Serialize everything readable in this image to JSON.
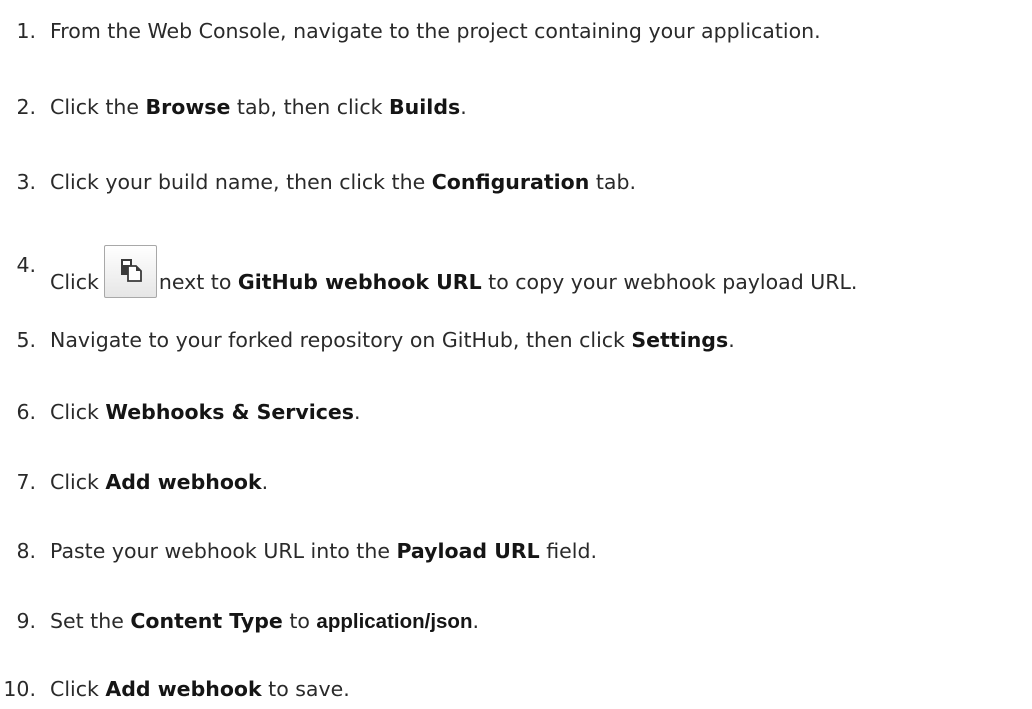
{
  "steps": [
    {
      "num": "1.",
      "parts": [
        {
          "t": "From the Web Console, navigate to the project containing your application."
        }
      ]
    },
    {
      "num": "2.",
      "parts": [
        {
          "t": "Click the "
        },
        {
          "t": "Browse",
          "bold": true
        },
        {
          "t": " tab, then click "
        },
        {
          "t": "Builds",
          "bold": true
        },
        {
          "t": "."
        }
      ]
    },
    {
      "num": "3.",
      "parts": [
        {
          "t": "Click your build name, then click the "
        },
        {
          "t": "Configuration",
          "bold": true
        },
        {
          "t": " tab."
        }
      ]
    },
    {
      "num": "4.",
      "parts": [
        {
          "t": "Click"
        },
        {
          "icon": "copy-to-clipboard-icon"
        },
        {
          "t": "next to "
        },
        {
          "t": "GitHub webhook URL",
          "bold": true
        },
        {
          "t": " to copy your webhook payload URL."
        }
      ]
    },
    {
      "num": "5.",
      "parts": [
        {
          "t": "Navigate to your forked repository on GitHub, then click "
        },
        {
          "t": "Settings",
          "bold": true
        },
        {
          "t": "."
        }
      ]
    },
    {
      "num": "6.",
      "parts": [
        {
          "t": "Click "
        },
        {
          "t": "Webhooks & Services",
          "bold": true
        },
        {
          "t": "."
        }
      ]
    },
    {
      "num": "7.",
      "parts": [
        {
          "t": "Click "
        },
        {
          "t": "Add webhook",
          "bold": true
        },
        {
          "t": "."
        }
      ]
    },
    {
      "num": "8.",
      "parts": [
        {
          "t": "Paste your webhook URL into the "
        },
        {
          "t": "Payload URL",
          "bold": true
        },
        {
          "t": " field."
        }
      ]
    },
    {
      "num": "9.",
      "parts": [
        {
          "t": "Set the "
        },
        {
          "t": "Content Type",
          "bold": true
        },
        {
          "t": " to "
        },
        {
          "t": "application/json",
          "bold": true
        },
        {
          "t": "."
        }
      ]
    },
    {
      "num": "10.",
      "parts": [
        {
          "t": "Click "
        },
        {
          "t": "Add webhook",
          "bold": true
        },
        {
          "t": " to save."
        }
      ]
    }
  ]
}
